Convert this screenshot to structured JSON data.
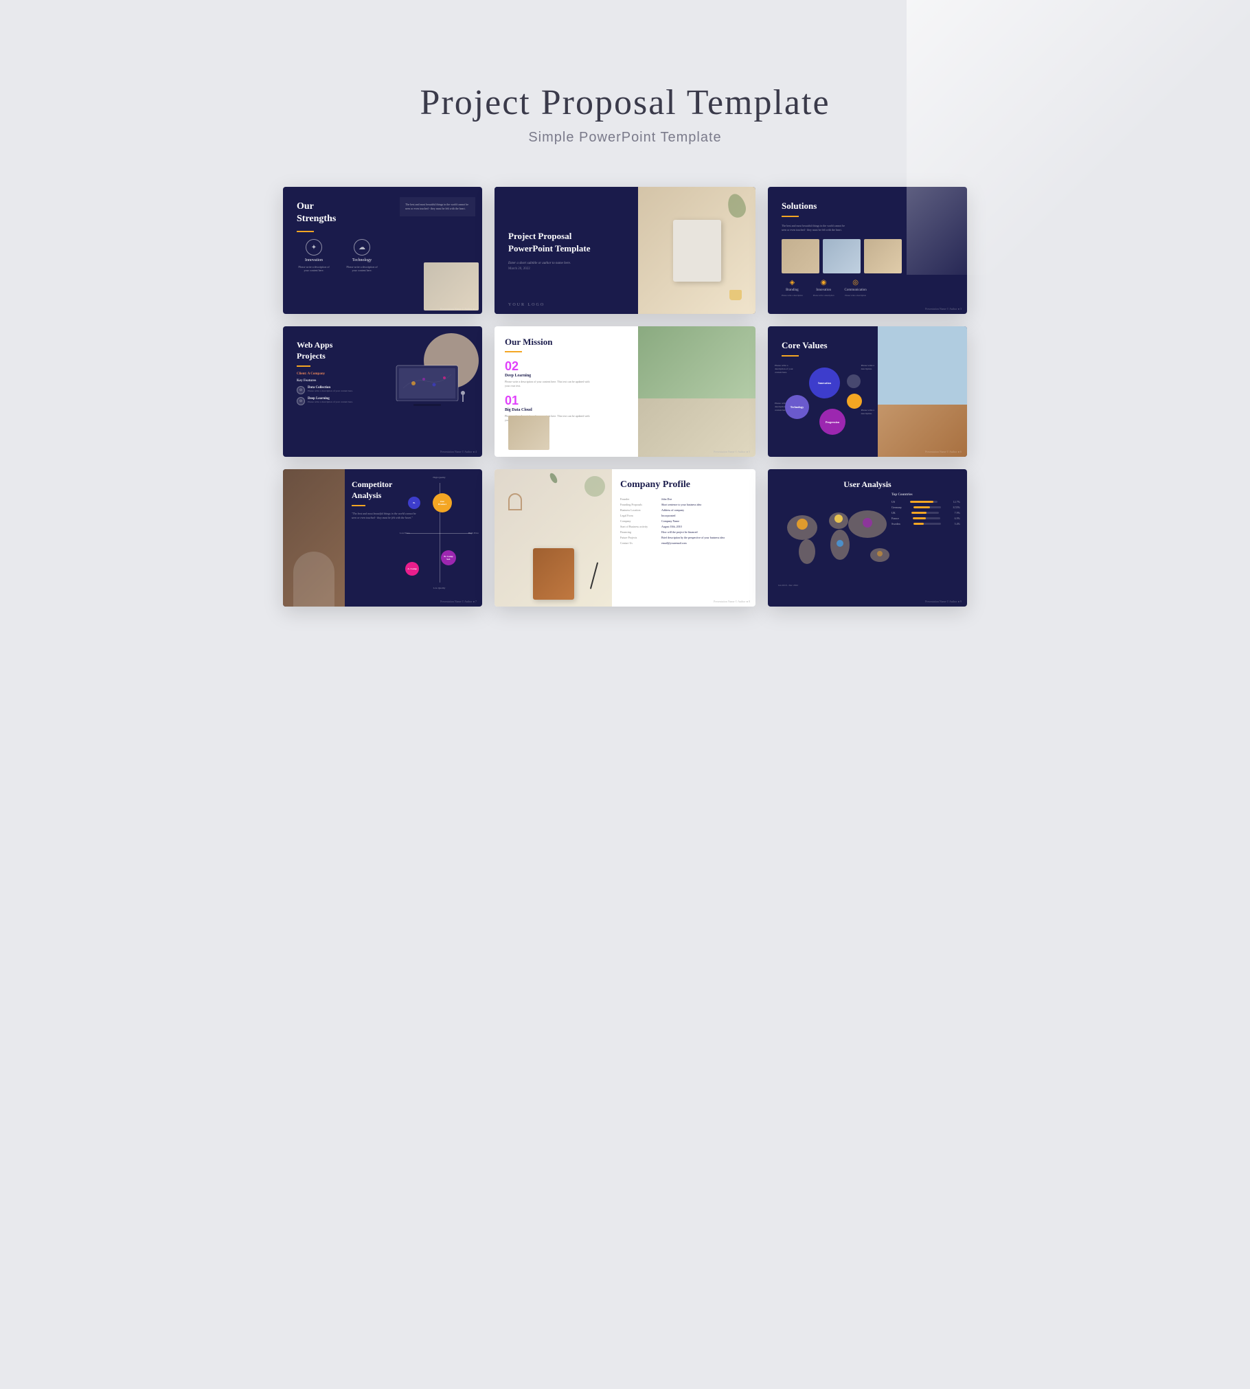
{
  "page": {
    "title": "Project Proposal Template",
    "subtitle": "Simple PowerPoint Template"
  },
  "slides": {
    "strengths": {
      "title": "Our\nStrengths",
      "icon1_label": "Innovation",
      "icon2_label": "Technology",
      "icon1_desc": "Please write a description of your content here.",
      "icon2_desc": "Please write a description of your content here."
    },
    "cover": {
      "title": "Project Proposal\nPowerPoint Template",
      "author": "Enter a short subtitle or author to name here.",
      "date": "March 20, 2022",
      "logo": "YOUR LOGO"
    },
    "solutions": {
      "title": "Solutions",
      "body": "The best and most beautiful things in the world cannot be seen or even touched - they must be felt with the heart.",
      "icon1": "Branding",
      "icon2": "Innovation",
      "icon3": "Communication",
      "icon1_desc": "Please write a description of your content here.",
      "icon2_desc": "Please write a description of your content here.",
      "icon3_desc": "Please write a description of your content here."
    },
    "webapps": {
      "title": "Web Apps\nProjects",
      "client": "Client: A Company",
      "features_label": "Key Features",
      "feature1_title": "Data Collection",
      "feature1_desc": "Please write a description of your content here. This text can be replaced with your own text.",
      "feature2_title": "Deep Learning",
      "feature2_desc": "Please write a description of your content here. This text can be replaced with your own text."
    },
    "mission": {
      "title": "Our Mission",
      "item1_num": "01",
      "item1_title": "Big Data Cloud",
      "item1_desc": "Please write a description of your content here. This text can be updated with your own text.",
      "item2_num": "02",
      "item2_title": "Deep Learning",
      "item2_desc": "Please write a description of your content here. This text can be updated with your own text."
    },
    "corevalues": {
      "title": "Core Values",
      "bubble1": "Innovation",
      "bubble2": "Technology",
      "bubble3": "Progression",
      "label1": "Please write a description of your content here.",
      "label2": "Please write a description of your content here.",
      "label3": "Please write a description of your content here.",
      "label4": "Please write a description of your content here.",
      "label5": "Please write a description of your content here."
    },
    "competitor": {
      "title": "Competitor\nAnalysis",
      "quote": "\"The best and most beautiful things in the world cannot be seen or even touched - they must be felt with the heart.\"",
      "axis_x_left": "Low Price",
      "axis_x_right": "High Price",
      "axis_y_top": "High Quality",
      "axis_y_bottom": "Low Quality",
      "bubble1": "Our\nProduct",
      "bubble2": "B. Competitor\nSolution",
      "bubble3": "A. Competitor\nSolution",
      "bubble4": "B. Competitor"
    },
    "profile": {
      "title": "Company Profile",
      "rows": [
        {
          "label": "Founder",
          "value": "John Doe"
        },
        {
          "label": "Founding Proposals",
          "value": "Short sentence to your business idea"
        },
        {
          "label": "Business Location",
          "value": "Address of company"
        },
        {
          "label": "Legal Form",
          "value": "Incorporated"
        },
        {
          "label": "Company",
          "value": "Company Name"
        },
        {
          "label": "Start of Business activity",
          "value": "August 10th, 2010"
        },
        {
          "label": "Financing",
          "value": "How will the project be financed"
        },
        {
          "label": "Future Projects",
          "value": "Brief description by the perspective of your business idea"
        },
        {
          "label": "Contact Us",
          "value": "email@youremail.com"
        }
      ]
    },
    "useranalysis": {
      "title": "User Analysis",
      "stats_title": "Top Countries",
      "stats": [
        {
          "label": "US",
          "pct": 12.7,
          "bar": 85
        },
        {
          "label": "Germany",
          "pct": 8.55,
          "bar": 60
        },
        {
          "label": "UK",
          "pct": 7.9,
          "bar": 55
        },
        {
          "label": "France",
          "pct": 6.9,
          "bar": 48
        },
        {
          "label": "Sweden",
          "pct": 5.4,
          "bar": 38
        }
      ]
    }
  }
}
